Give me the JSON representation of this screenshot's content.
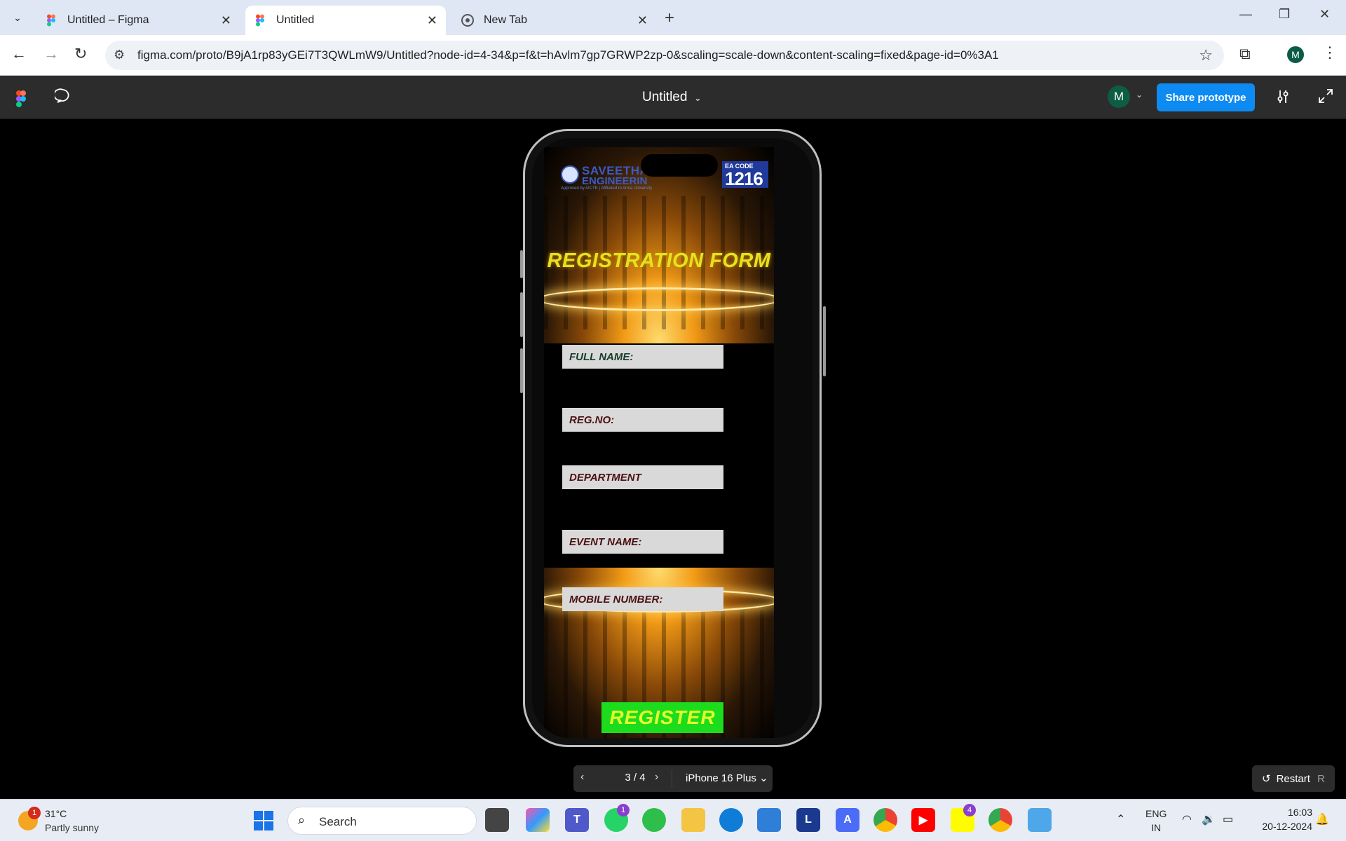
{
  "browser": {
    "tabs": [
      {
        "title": "Untitled – Figma",
        "active": false
      },
      {
        "title": "Untitled",
        "active": true
      },
      {
        "title": "New Tab",
        "active": false
      }
    ],
    "url": "figma.com/proto/B9jA1rp83yGEi7T3QWLmW9/Untitled?node-id=4-34&p=f&t=hAvlm7gp7GRWP2zp-0&scaling=scale-down&content-scaling=fixed&page-id=0%3A1",
    "profile_initial": "M"
  },
  "figma": {
    "title": "Untitled",
    "avatar_initial": "M",
    "share_label": "Share prototype",
    "accent_color": "#0d8bf2"
  },
  "prototype": {
    "logo_line1": "SAVEETHA",
    "logo_line2": "ENGINEERIN",
    "logo_subtitle": "Approved by AICTE | Affiliated to Anna University",
    "code_label": "EA CODE",
    "code_number": "1216",
    "heading": "REGISTRATION FORM",
    "fields": [
      {
        "label": "FULL NAME:"
      },
      {
        "label": "REG.NO:"
      },
      {
        "label": "DEPARTMENT"
      },
      {
        "label": "EVENT NAME:"
      },
      {
        "label": "MOBILE NUMBER:"
      }
    ],
    "register_label": "REGISTER",
    "heading_color": "#e4e21e",
    "register_bg": "#1ddc1d"
  },
  "viewer": {
    "page_counter": "3 / 4",
    "device": "iPhone 16 Plus",
    "restart_label": "Restart",
    "restart_shortcut": "R"
  },
  "taskbar": {
    "weather_temp": "31°C",
    "weather_cond": "Partly sunny",
    "weather_badge": "1",
    "search_placeholder": "Search",
    "whatsapp_badge": "1",
    "snapchat_badge": "4",
    "lang_line1": "ENG",
    "lang_line2": "IN",
    "time": "16:03",
    "date": "20-12-2024"
  }
}
